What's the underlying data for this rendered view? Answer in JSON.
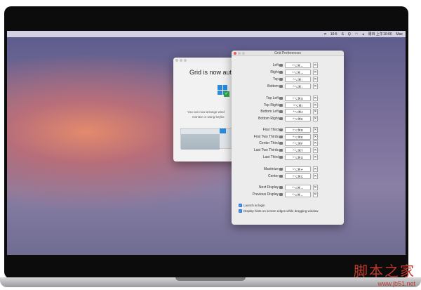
{
  "menubar": {
    "items": [
      "10:5",
      "S",
      "Q",
      "周日 上午10:00",
      "Mac"
    ]
  },
  "welcome": {
    "title": "Grid is now aut",
    "line1": "You can now arrange wind",
    "line2": "monitor or using keybo"
  },
  "prefs": {
    "title": "Grid Preferences",
    "rows": [
      {
        "label": "Left",
        "shortcut": "^⌥⌘←"
      },
      {
        "label": "Right",
        "shortcut": "^⌥⌘→"
      },
      {
        "label": "Top",
        "shortcut": "^⌥⌘↑"
      },
      {
        "label": "Bottom",
        "shortcut": "^⌥⌘↓"
      },
      {
        "label": "Top Left",
        "shortcut": "^⌥⌘U"
      },
      {
        "label": "Top Right",
        "shortcut": "^⌥⌘I"
      },
      {
        "label": "Bottom Left",
        "shortcut": "^⌥⌘J"
      },
      {
        "label": "Bottom Right",
        "shortcut": "^⌥⌘K"
      },
      {
        "label": "First Third",
        "shortcut": "^⌥⌘D"
      },
      {
        "label": "First Two Thirds",
        "shortcut": "^⌥⌘E"
      },
      {
        "label": "Center Third",
        "shortcut": "^⌥⌘F"
      },
      {
        "label": "Last Two Thirds",
        "shortcut": "^⌥⌘T"
      },
      {
        "label": "Last Third",
        "shortcut": "^⌥⌘G"
      },
      {
        "label": "Maximize",
        "shortcut": "^⌥⌘↩"
      },
      {
        "label": "Center",
        "shortcut": "^⌥⌘C"
      },
      {
        "label": "Next Display",
        "shortcut": "^⌥⌘→"
      },
      {
        "label": "Previous Display",
        "shortcut": "^⌥⌘←"
      }
    ],
    "clear": "✕",
    "launch_at_login": "Launch at login",
    "display_hints": "Display hints on screen edges while dragging window"
  },
  "watermark": {
    "name": "脚本之家",
    "url": "www.jb51.net"
  }
}
